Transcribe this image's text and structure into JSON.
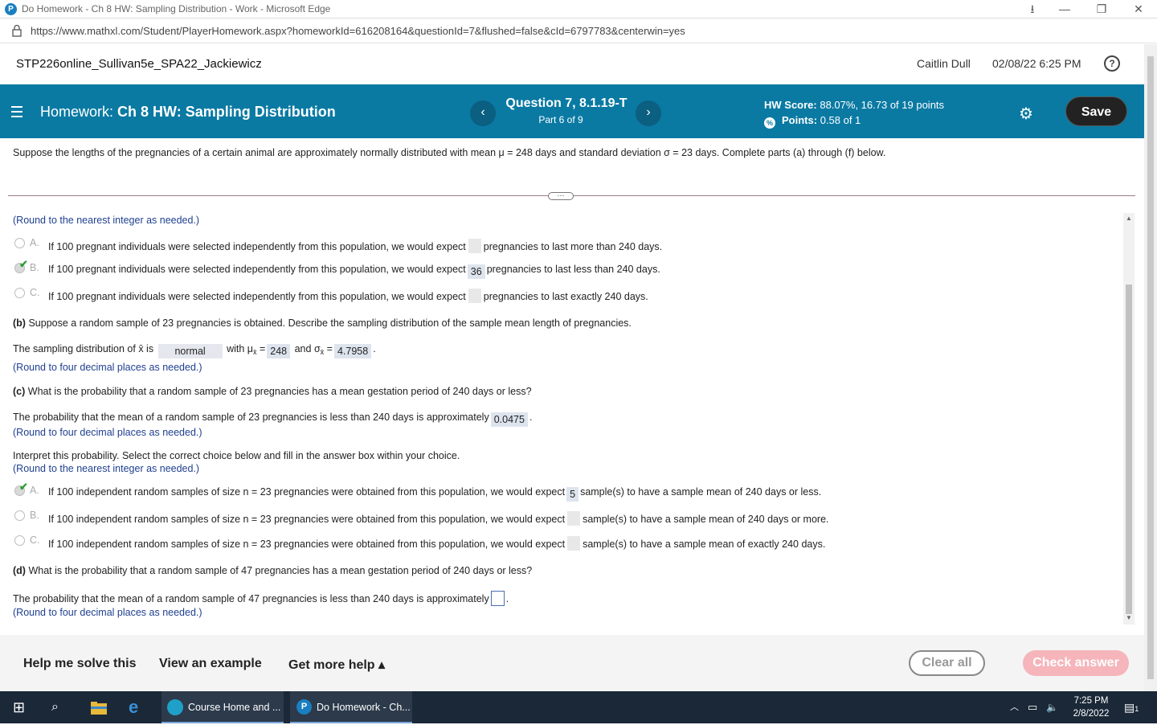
{
  "browser": {
    "window_title": "Do Homework - Ch 8 HW: Sampling Distribution - Work - Microsoft Edge",
    "url": "https://www.mathxl.com/Student/PlayerHomework.aspx?homeworkId=616208164&questionId=7&flushed=false&cId=6797783&centerwin=yes"
  },
  "course_bar": {
    "course_name": "STP226online_Sullivan5e_SPA22_Jackiewicz",
    "user": "Caitlin Dull",
    "datetime": "02/08/22 6:25 PM",
    "help_icon": "?"
  },
  "hw_bar": {
    "label": "Homework:",
    "title": "Ch 8 HW: Sampling Distribution",
    "question": "Question 7, 8.1.19-T",
    "part": "Part 6 of 9",
    "score_label": "HW Score:",
    "score_value": "88.07%, 16.73 of 19 points",
    "points_label": "Points:",
    "points_value": "0.58 of 1",
    "save_label": "Save",
    "prev": "‹",
    "next": "›"
  },
  "question_stem": "Suppose the lengths of the pregnancies of a certain animal are approximately normally distributed with mean μ = 248 days and standard deviation σ = 23 days. Complete parts (a) through (f) below.",
  "part_a": {
    "round_note": "(Round to the nearest integer as needed.)",
    "options": [
      {
        "letter": "A.",
        "before": "If 100 pregnant individuals were selected independently from this population, we would expect",
        "answer": "",
        "after": "pregnancies to last more than 240 days."
      },
      {
        "letter": "B.",
        "before": "If 100 pregnant individuals were selected independently from this population, we would expect",
        "answer": "36",
        "after": "pregnancies to last less than 240 days."
      },
      {
        "letter": "C.",
        "before": "If 100 pregnant individuals were selected independently from this population, we would expect",
        "answer": "",
        "after": "pregnancies to last exactly 240 days."
      }
    ]
  },
  "part_b": {
    "label": "(b)",
    "question": "Suppose a random sample of 23 pregnancies is obtained. Describe the sampling distribution of the sample mean length of pregnancies.",
    "text1": "The sampling distribution of x̄ is",
    "distribution": "normal",
    "text2": "with μ",
    "sub": "x̄",
    "eq": "=",
    "mu": "248",
    "text3": "and σ",
    "sigma": "4.7958",
    "round_note": "(Round to four decimal places as needed.)"
  },
  "part_c": {
    "label": "(c)",
    "question": "What is the probability that a random sample of 23 pregnancies has a mean gestation period of 240 days or less?",
    "text": "The probability that the mean of a random sample of 23 pregnancies is less than 240 days is approximately",
    "answer": "0.0475",
    "round_note": "(Round to four decimal places as needed.)",
    "interpret": "Interpret this probability. Select the correct choice below and fill in the answer box within your choice.",
    "round_note2": "(Round to the nearest integer as needed.)",
    "options": [
      {
        "letter": "A.",
        "before": "If 100 independent random samples of size n = 23 pregnancies were obtained from this population, we would expect",
        "answer": "5",
        "after": "sample(s) to have a sample mean of 240 days or less."
      },
      {
        "letter": "B.",
        "before": "If 100 independent random samples of size n = 23 pregnancies were obtained from this population, we would expect",
        "answer": "",
        "after": "sample(s) to have a sample mean of 240 days or more."
      },
      {
        "letter": "C.",
        "before": "If 100 independent random samples of size n = 23 pregnancies were obtained from this population, we would expect",
        "answer": "",
        "after": "sample(s) to have a sample mean of exactly 240 days."
      }
    ]
  },
  "part_d": {
    "label": "(d)",
    "question": "What is the probability that a random sample of 47 pregnancies has a mean gestation period of 240 days or less?",
    "text": "The probability that the mean of a random sample of 47 pregnancies is less than 240 days is approximately",
    "round_note": "(Round to four decimal places as needed.)"
  },
  "footer": {
    "help_solve": "Help me solve this",
    "view_example": "View an example",
    "more_help": "Get more help ▴",
    "clear_all": "Clear all",
    "check_answer": "Check answer"
  },
  "taskbar": {
    "app1": "Course Home and ...",
    "app2": "Do Homework - Ch...",
    "time": "7:25 PM",
    "date": "2/8/2022",
    "notif_count": "1"
  },
  "colors": {
    "header_bg": "#0a7aa3",
    "check_green": "#2e9e36",
    "check_answer_bg": "#f5b5bb"
  }
}
